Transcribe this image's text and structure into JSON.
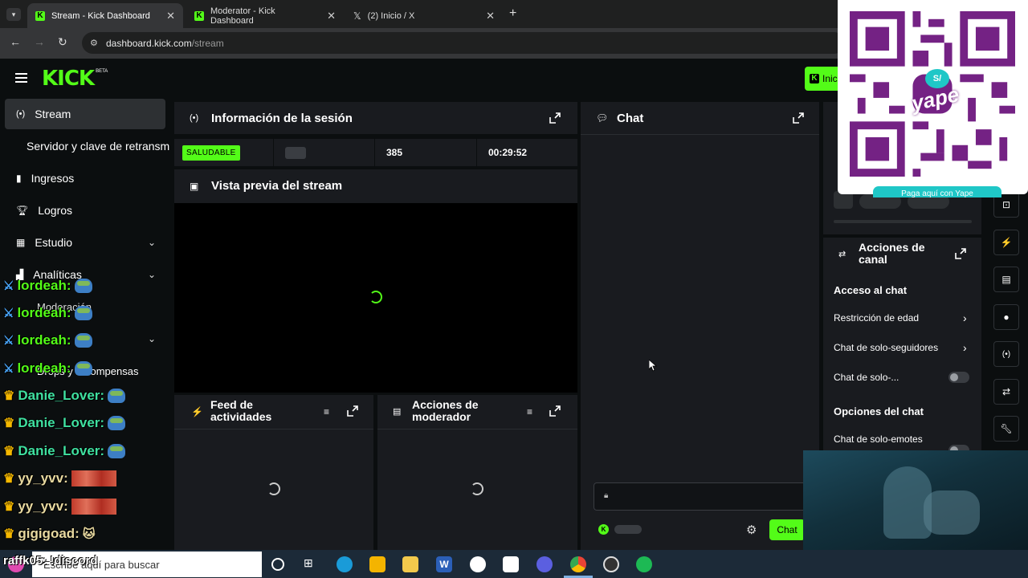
{
  "browser": {
    "tabs": [
      {
        "title": "Stream - Kick Dashboard",
        "icon": "kick-icon"
      },
      {
        "title": "Moderator - Kick Dashboard",
        "icon": "kick-icon"
      },
      {
        "title": "(2) Inicio / X",
        "icon": "x-icon"
      }
    ],
    "url_domain": "dashboard.kick.com",
    "url_path": "/stream"
  },
  "app": {
    "logo": "KICK",
    "logo_badge": "BETA",
    "top_button_partial": "Inic",
    "sidebar": {
      "items": [
        {
          "label": "Stream",
          "icon": "broadcast-icon"
        },
        {
          "label": "Servidor y clave de retransm",
          "icon": ""
        },
        {
          "label": "Ingresos",
          "icon": "chart-icon"
        },
        {
          "label": "Logros",
          "icon": "trophy-icon"
        },
        {
          "label": "Estudio",
          "icon": "studio-icon"
        },
        {
          "label": "Analíticas",
          "icon": "analytics-icon"
        },
        {
          "label": "Moderación",
          "icon": ""
        },
        {
          "label": "Drops y recompensas",
          "icon": ""
        }
      ]
    },
    "session": {
      "title": "Información de la sesión",
      "health": "SALUDABLE",
      "viewers": "385",
      "uptime": "00:29:52"
    },
    "preview": {
      "title": "Vista previa del stream"
    },
    "activity_feed": {
      "title_line1": "Feed de",
      "title_line2": "actividades"
    },
    "mod_actions": {
      "title_line1": "Acciones de",
      "title_line2": "moderador"
    },
    "chat": {
      "title": "Chat",
      "send_button": "Chat"
    },
    "channel_actions": {
      "title_line1": "Acciones de",
      "title_line2": "canal",
      "chat_access_heading": "Acceso al chat",
      "items": [
        {
          "label": "Restricción de edad",
          "type": "link"
        },
        {
          "label": "Chat de solo-seguidores",
          "type": "link"
        },
        {
          "label": "Chat de solo-...",
          "type": "toggle"
        }
      ],
      "chat_options_heading": "Opciones del chat",
      "options": [
        {
          "label": "Chat de solo-emotes",
          "type": "toggle"
        }
      ]
    }
  },
  "qr_overlay": {
    "brand": "yape",
    "currency": "S/",
    "caption": "Paga aquí con Yape"
  },
  "stream_overlay_chat": [
    {
      "user": "lordeah:",
      "badge": "sword",
      "emote": "pepe"
    },
    {
      "user": "lordeah:",
      "badge": "sword",
      "emote": "pepe"
    },
    {
      "user": "lordeah:",
      "badge": "sword",
      "emote": "pepe"
    },
    {
      "user": "lordeah:",
      "badge": "sword",
      "emote": "pepe"
    },
    {
      "user": "Danie_Lover:",
      "badge": "crown",
      "emote": "pepe"
    },
    {
      "user": "Danie_Lover:",
      "badge": "crown",
      "emote": "pepe"
    },
    {
      "user": "Danie_Lover:",
      "badge": "crown",
      "emote": "pepe"
    },
    {
      "user": "yy_yvv:",
      "badge": "crown",
      "emote": "strip"
    },
    {
      "user": "yy_yvv:",
      "badge": "crown",
      "emote": "strip"
    },
    {
      "user": "gigigoad:",
      "badge": "crown",
      "emote": "cat"
    },
    {
      "user": "raffk05: !discord",
      "badge": "",
      "emote": ""
    }
  ],
  "taskbar": {
    "search_placeholder": "Escribe aquí para buscar"
  },
  "colors": {
    "kick_green": "#53fc18",
    "panel_bg": "#191b1f",
    "app_bg": "#0b0e0f",
    "yape_purple": "#742284"
  }
}
